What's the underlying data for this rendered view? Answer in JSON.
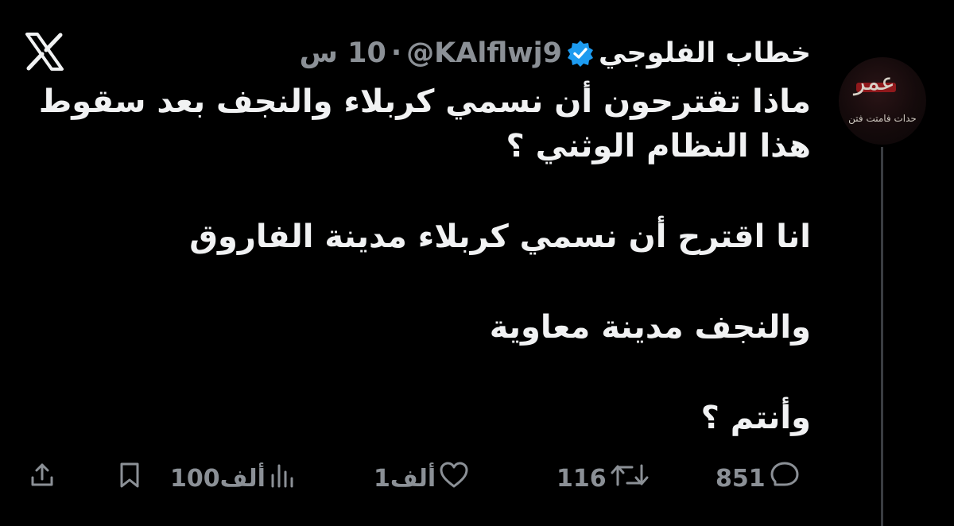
{
  "app": {
    "logo_icon": "x-logo-icon"
  },
  "colors": {
    "background": "#000000",
    "text_primary": "#f1f2f3",
    "text_secondary": "#8b9096",
    "verified_badge": "#1d9bf0",
    "thread_line": "#3a3d41"
  },
  "avatar": {
    "main_text": "عمر",
    "sub_text": "حدات فامتت فتن"
  },
  "tweet": {
    "author_name": "خطاب الفلوجي",
    "verified_icon": "verified-badge-icon",
    "handle": "@KAlflwj9",
    "separator": "·",
    "time": "10 س",
    "lines": [
      "ماذا تقترحون أن نسمي كربلاء والنجف بعد سقوط",
      "هذا النظام الوثني ؟",
      "انا اقترح أن نسمي كربلاء مدينة الفاروق",
      "والنجف مدينة معاوية",
      "وأنتم ؟"
    ]
  },
  "actions": {
    "replies": {
      "icon": "reply-icon",
      "count": "851"
    },
    "reposts": {
      "icon": "repost-icon",
      "count": "116"
    },
    "likes": {
      "icon": "heart-icon",
      "count": "1ألف"
    },
    "views": {
      "icon": "views-chart-icon",
      "count": "100ألف"
    },
    "bookmark": {
      "icon": "bookmark-icon"
    },
    "share": {
      "icon": "share-icon"
    }
  }
}
